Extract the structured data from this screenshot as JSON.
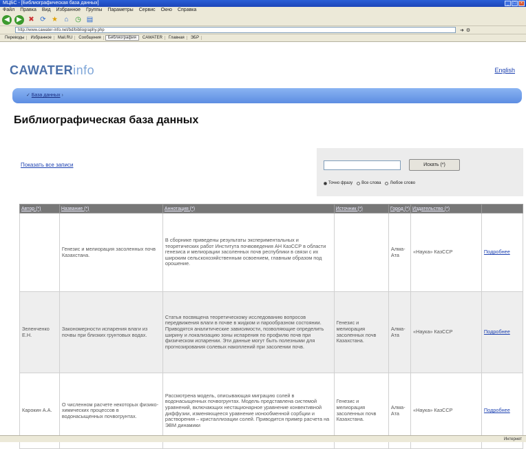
{
  "browser": {
    "title": "МЦБС - [Библиографическая база данных]",
    "menu": [
      "Файл",
      "Правка",
      "Вид",
      "Избранное",
      "Группы",
      "Параметры",
      "Сервис",
      "Окно",
      "Справка"
    ],
    "address": "http://www.cawater-info.net/bd/bibliography.php",
    "links": [
      "Переводы",
      "Избранное",
      "Mail.RU",
      "Сообщения",
      "Библиография",
      "CAWATER",
      "Главная",
      "ЭБР"
    ],
    "active_link_index": 4
  },
  "site": {
    "logo_main": "CAWATER",
    "logo_suffix": "info",
    "lang_link": "English",
    "breadcrumb_current": "База данных"
  },
  "page": {
    "title": "Библиографическая база данных",
    "show_all": "Показать все записи"
  },
  "search": {
    "input_value": "",
    "button_label": "Искать (*)",
    "options": [
      {
        "label": "Точно фразу",
        "selected": true
      },
      {
        "label": "Все слова",
        "selected": false
      },
      {
        "label": "Любое слово",
        "selected": false
      }
    ]
  },
  "table": {
    "columns": [
      "Автор (*)",
      "Название (*)",
      "Аннотация (*)",
      "Источник (*)",
      "Город (*)",
      "Издательство (*)",
      ""
    ],
    "rows": [
      {
        "author": "",
        "title": "Генезис и мелиорация засоленных почв Казахстана.",
        "annotation": "В сборнике приведены результаты экспериментальных и теоретических работ Института почвоведения АН КазССР в области генезиса и мелиорации засоленных почв республики в связи с их широким сельскохозяйственным освоением, главным образом под орошение.",
        "source": "",
        "city": "Алма-Ата",
        "publisher": "«Наука» КазССР",
        "more": "Подробнее"
      },
      {
        "author": "Зеленченко Е.Н.",
        "title": "Закономерности испарения влаги из почвы при близких грунтовых водах.",
        "annotation": "Статья посвящена теоретическому исследованию вопросов передвижения влаги в почве в жидком и парообразном состоянии. Приводятся аналитические зависимости, позволяющие определить ширину и локализацию зоны испарения по профилю почв при физическом испарении. Эти данные могут быть полезными для прогнозирования солевых накоплений при засолении почв.",
        "source": "Генезис и мелиорация засоленных почв Казахстана.",
        "city": "Алма-Ата",
        "publisher": "«Наука» КазССР",
        "more": "Подробнее"
      },
      {
        "author": "Карокин А.А.",
        "title": "О численном расчете некоторых физико-химических процессов в водонасыщенных почвогрунтах.",
        "annotation": "Рассмотрена модель, описывающая миграцию солей в водонасыщенных почвогрунтах. Модель представлена системой уравнений, включающих нестационарное уравнение конвективной диффузии, изменяющееся уравнение ионообменной сорбции и растворения – кристаллизации солей. Приводится пример расчета на ЭВМ динамики",
        "source": "Генезис и мелиорация засоленных почв Казахстана.",
        "city": "Алма-Ата",
        "publisher": "«Наука» КазССР",
        "more": "Подробнее"
      }
    ]
  },
  "status": {
    "text": "Интернет"
  }
}
